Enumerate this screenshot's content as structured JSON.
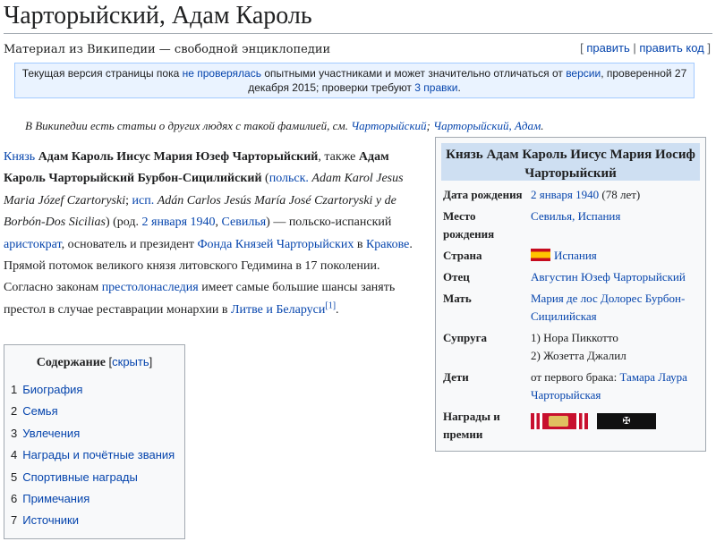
{
  "title": "Чарторыйский, Адам Кароль",
  "tagline": "Материал из Википедии — свободной энциклопедии",
  "edit": {
    "edit_label": "править",
    "edit_code_label": "править код"
  },
  "notice": {
    "p1": "Текущая версия страницы пока ",
    "l1": "не проверялась",
    "p2": " опытными участниками и может значительно отличаться от ",
    "l2": "версии",
    "p3": ", проверенной 27 декабря 2015; проверки требуют ",
    "l3": "3 правки",
    "p4": "."
  },
  "hatnote": {
    "p1": "В Википедии есть статьи о других людях с такой фамилией, см. ",
    "l1": "Чарторыйский",
    "p2": "; ",
    "l2": "Чарторыйский, Адам",
    "p3": "."
  },
  "lead": {
    "l_prince": "Князь",
    "b_name": "Адам Кароль Иисус Мария Юзеф Чарторыйский",
    "t1": ", также ",
    "b_name2": "Адам Кароль Чарторыйский Бурбон-Сицилийский",
    "t2": " (",
    "l_pol": "польск.",
    "i_pol": "Adam Karol Jesus Maria Józef Czartoryski",
    "t3": "; ",
    "l_isp": "исп.",
    "i_isp": "Adán Carlos Jesús María José Czartoryski y de Borbón-Dos Sicilias",
    "t4": ") (род. ",
    "l_date": "2 января 1940",
    "t5": ", ",
    "l_sev": "Севилья",
    "t6": ") — польско-испанский ",
    "l_aristo": "аристократ",
    "t7": ", основатель и президент ",
    "l_fund": "Фонда Князей Чарторыйских",
    "t8": " в ",
    "l_krak": "Кракове",
    "t9": ". Прямой потомок великого князя литовского Гедимина в 17 поколении. Согласно законам ",
    "l_succ": "престолонаследия",
    "t10": " имеет самые большие шансы занять престол в случае реставрации монархии в ",
    "l_lit": "Литве и Беларуси",
    "ref": "[1]",
    "t11": "."
  },
  "toc": {
    "heading": "Содержание",
    "hide_label": "скрыть",
    "items": [
      {
        "num": "1",
        "label": "Биография"
      },
      {
        "num": "2",
        "label": "Семья"
      },
      {
        "num": "3",
        "label": "Увлечения"
      },
      {
        "num": "4",
        "label": "Награды и почётные звания"
      },
      {
        "num": "5",
        "label": "Спортивные награды"
      },
      {
        "num": "6",
        "label": "Примечания"
      },
      {
        "num": "7",
        "label": "Источники"
      }
    ]
  },
  "infobox": {
    "title": "Князь Адам Кароль Иисус Мария Иосиф Чарторыйский",
    "birth_label": "Дата рождения",
    "birth_link": "2 января 1940",
    "birth_age": " (78 лет)",
    "place_label": "Место рождения",
    "place_link": "Севилья, Испания",
    "country_label": "Страна",
    "country_link": "Испания",
    "father_label": "Отец",
    "father_link": "Августин Юзеф Чарторыйский",
    "mother_label": "Мать",
    "mother_link": "Мария де лос Долорес Бурбон-Сицилийская",
    "spouse_label": "Супруга",
    "spouse1": "1) Нора Пиккотто",
    "spouse2": "2) Жозетта Джалил",
    "children_label": "Дети",
    "children_prefix": "от первого брака: ",
    "children_link": "Тамара Лаура Чарторыйская",
    "awards_label": "Награды и премии",
    "flag_icon": "spain-flag-icon",
    "award_icons": [
      "order-ribbon-red",
      "order-ribbon-black"
    ]
  }
}
